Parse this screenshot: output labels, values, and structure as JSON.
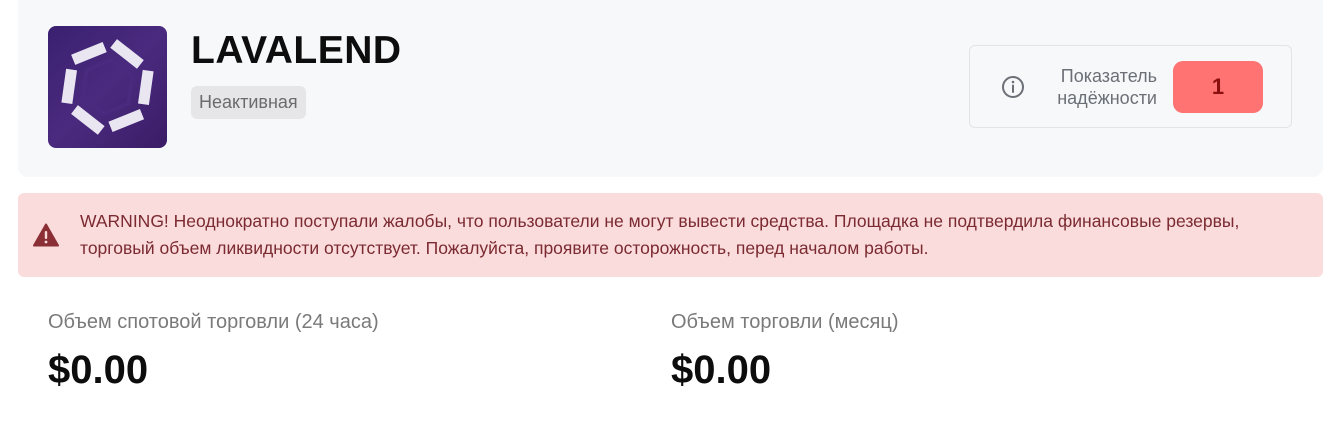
{
  "exchange": {
    "name": "LAVALEND",
    "status": "Неактивная",
    "logo_icon": "lavalend-hexagon-logo-icon"
  },
  "trust": {
    "label": "Показатель надёжности",
    "score": "1",
    "score_color": "#ff7373",
    "icon": "info-icon"
  },
  "warning": {
    "icon": "warning-triangle-icon",
    "text": "WARNING! Неоднократно поступали жалобы, что пользователи не могут вывести средства. Площадка не подтвердила финансовые резервы, торговый объем ликвидности отсутствует. Пожалуйста, проявите осторожность, перед началом работы.",
    "background": "#fbdcdc"
  },
  "stats": [
    {
      "label": "Объем спотовой торговли (24 часа)",
      "value": "$0.00"
    },
    {
      "label": "Объем торговли (месяц)",
      "value": "$0.00"
    }
  ]
}
